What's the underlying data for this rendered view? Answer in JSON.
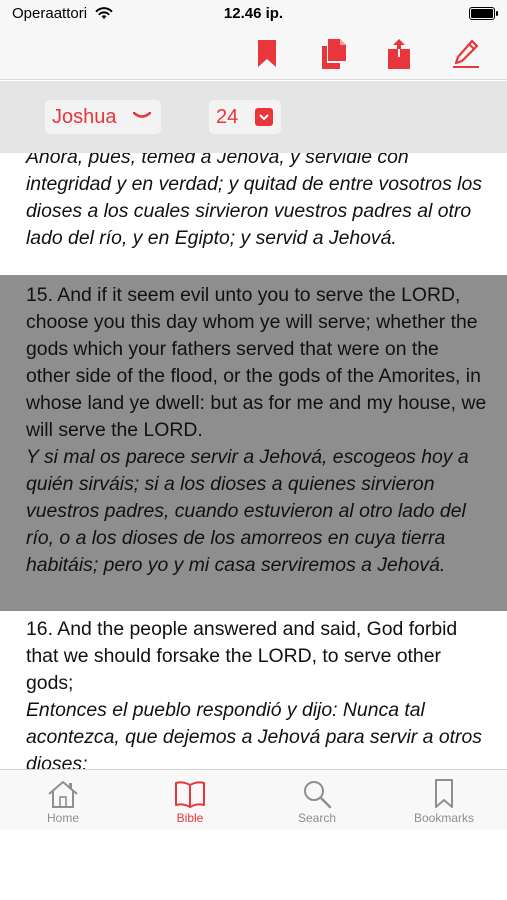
{
  "status": {
    "carrier": "Operaattori",
    "time": "12.46 ip.",
    "battery_level": 0.9
  },
  "toolbar": {
    "icons": [
      "bookmark-icon",
      "copy-icon",
      "share-icon",
      "edit-icon"
    ]
  },
  "selector": {
    "book": "Joshua",
    "chapter": "24"
  },
  "colors": {
    "accent": "#e8363b",
    "highlight_bg": "#8e8e8e",
    "tab_inactive": "#8e8e93"
  },
  "verses": {
    "prev": {
      "es": "Ahora, pues, temed a Jehová, y servidle con integridad y en verdad; y quitad de entre vosotros los dioses a los cuales sirvieron vuestros padres al otro lado del río, y en Egipto; y servid a Jehová."
    },
    "v15": {
      "en": "15. And if it seem evil unto you to serve the LORD, choose you this day whom ye will serve; whether the gods which your fathers served that were on the other side of the flood, or the gods of the Amorites, in whose land ye dwell: but as for me and my house, we will serve the LORD.",
      "es": " Y si mal os parece servir a Jehová, escogeos hoy a quién sirváis; si a los dioses a quienes sirvieron vuestros padres, cuando estuvieron al otro lado del río, o a los dioses de los amorreos en cuya tierra habitáis; pero yo y mi casa serviremos a Jehová."
    },
    "v16": {
      "en": "16. And the people answered and said, God forbid that we should forsake the LORD, to serve other gods;",
      "es": " Entonces el pueblo respondió y dijo: Nunca tal acontezca, que dejemos a Jehová para servir a otros dioses;"
    }
  },
  "tabs": [
    {
      "label": "Home",
      "icon": "home-icon"
    },
    {
      "label": "Bible",
      "icon": "book-icon",
      "active": true
    },
    {
      "label": "Search",
      "icon": "search-icon"
    },
    {
      "label": "Bookmarks",
      "icon": "bookmark-icon"
    }
  ]
}
